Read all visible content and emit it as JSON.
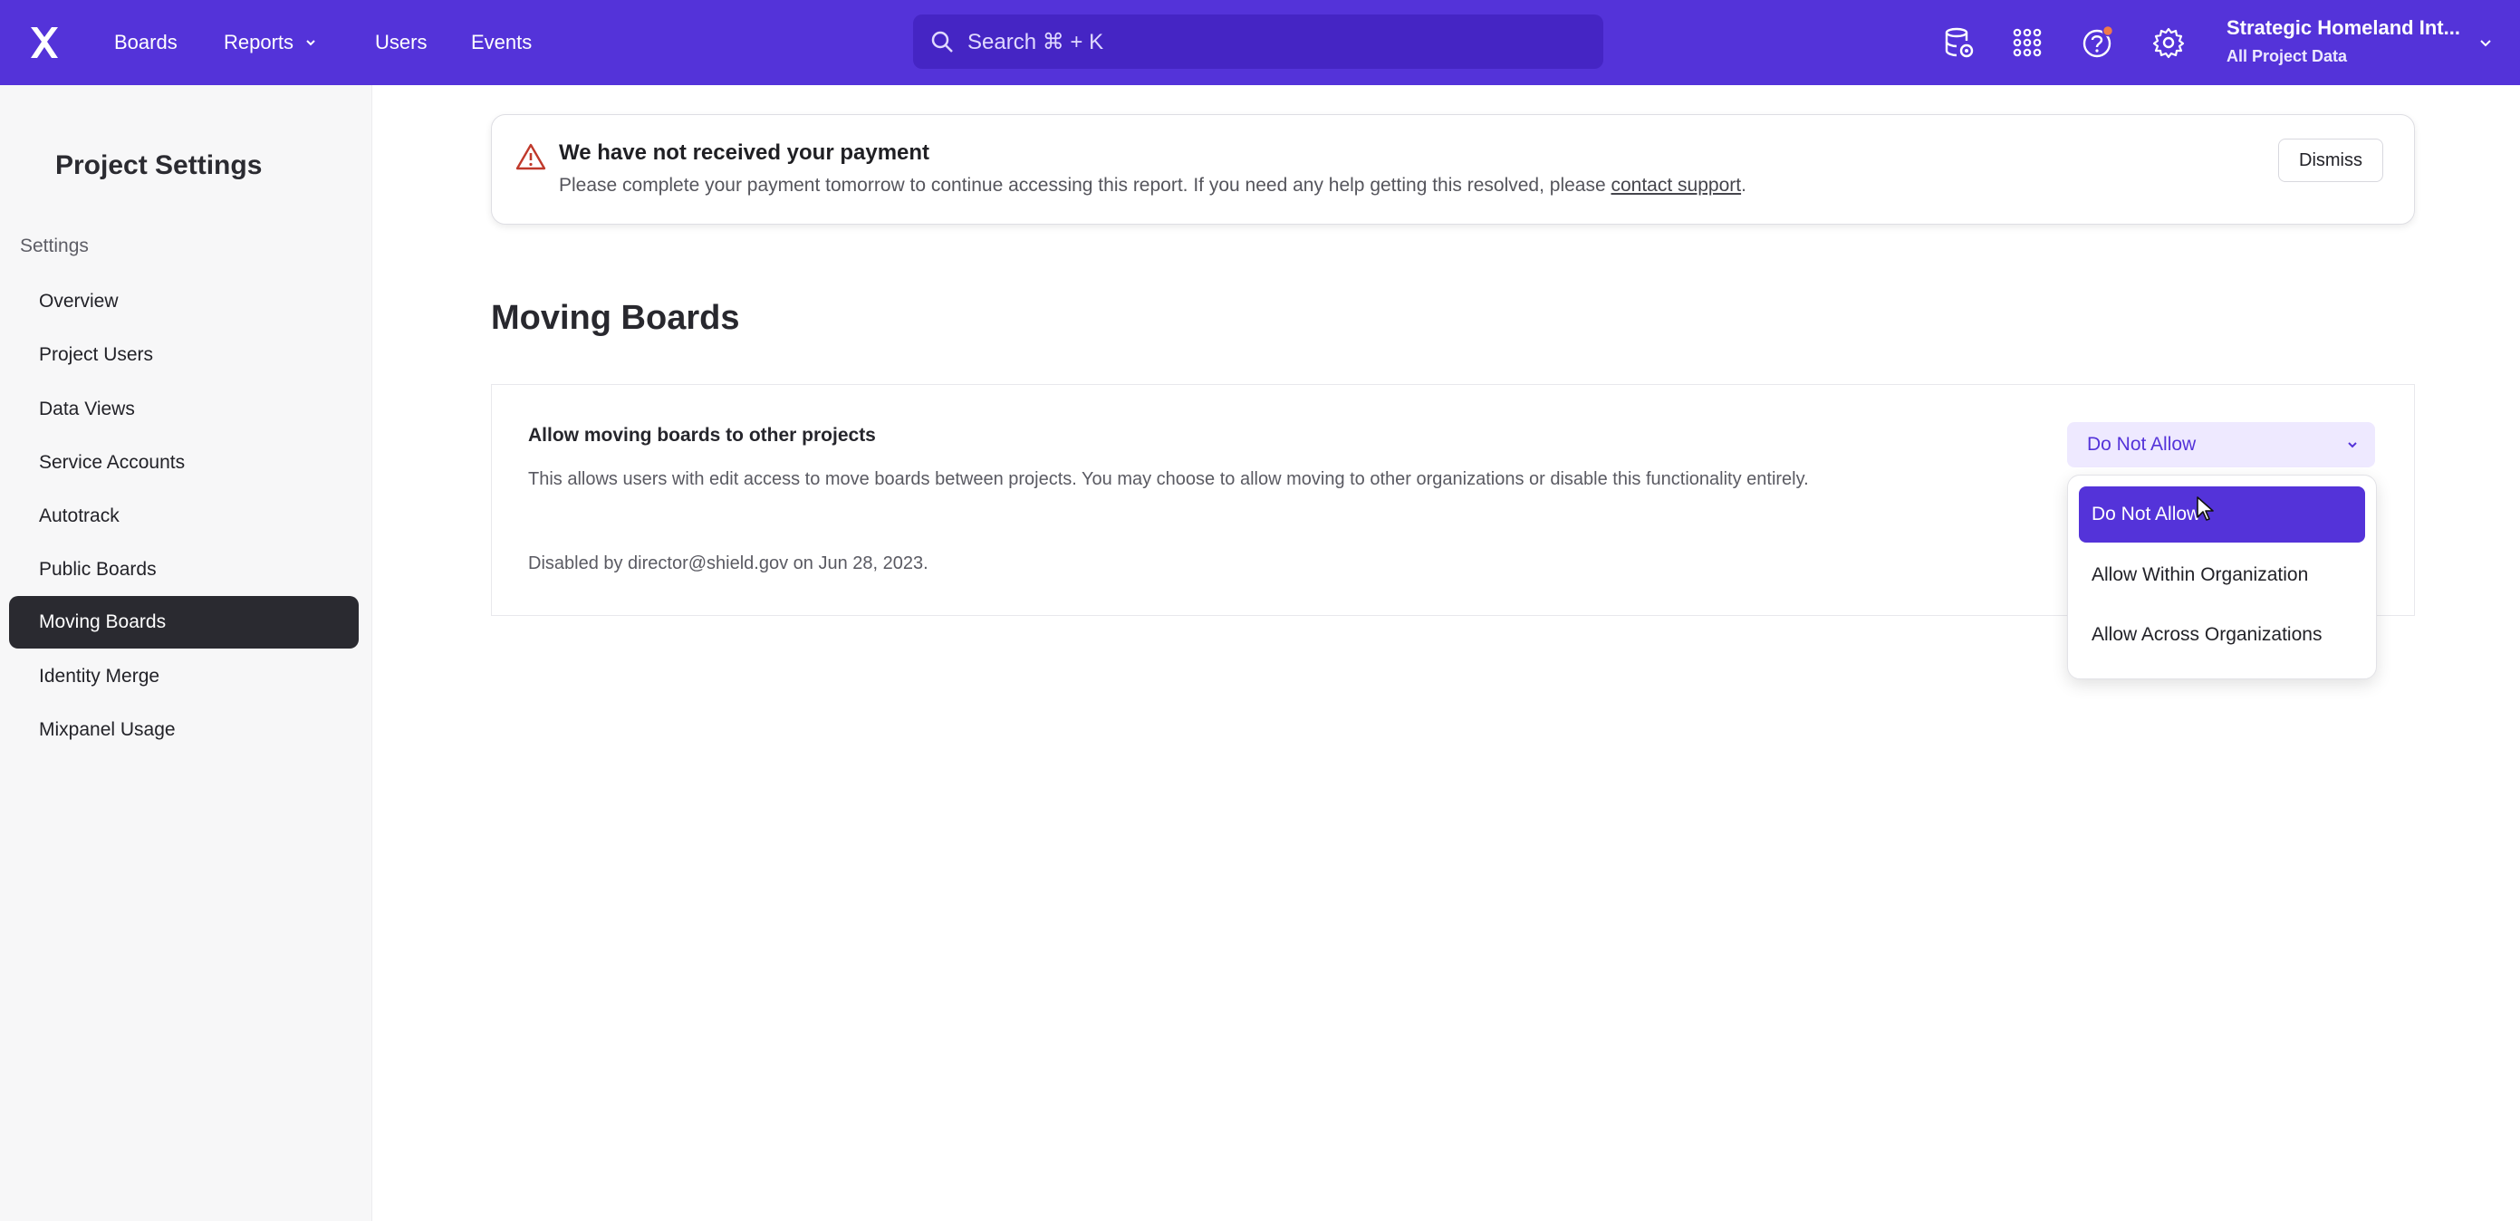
{
  "topbar": {
    "nav": [
      {
        "label": "Boards"
      },
      {
        "label": "Reports"
      },
      {
        "label": "Users"
      },
      {
        "label": "Events"
      }
    ],
    "search_placeholder": "Search  ⌘ + K",
    "org_name": "Strategic Homeland Int...",
    "org_sub": "All Project Data",
    "icons": [
      "database-settings-icon",
      "apps-grid-icon",
      "help-icon",
      "gear-icon"
    ],
    "brand_color": "#5433d9"
  },
  "sidebar": {
    "title": "Project Settings",
    "section": "Settings",
    "items": [
      {
        "label": "Overview"
      },
      {
        "label": "Project Users"
      },
      {
        "label": "Data Views"
      },
      {
        "label": "Service Accounts"
      },
      {
        "label": "Autotrack"
      },
      {
        "label": "Public Boards"
      },
      {
        "label": "Moving Boards",
        "active": true
      },
      {
        "label": "Identity Merge"
      },
      {
        "label": "Mixpanel Usage"
      }
    ]
  },
  "banner": {
    "title": "We have not received your payment",
    "desc_prefix": "Please complete your payment tomorrow to continue accessing this report. If you need any help getting this resolved, please ",
    "link": "contact support",
    "desc_suffix": ".",
    "dismiss": "Dismiss"
  },
  "main": {
    "title": "Moving Boards",
    "card_title": "Allow moving boards to other projects",
    "card_desc": "This allows users with edit access to move boards between projects. You may choose to allow moving to other organizations or disable this functionality entirely.",
    "card_status": "Disabled by director@shield.gov on Jun 28, 2023.",
    "select_value": "Do Not Allow",
    "options": [
      {
        "label": "Do Not Allow",
        "selected": true
      },
      {
        "label": "Allow Within Organization"
      },
      {
        "label": "Allow Across Organizations"
      }
    ]
  }
}
